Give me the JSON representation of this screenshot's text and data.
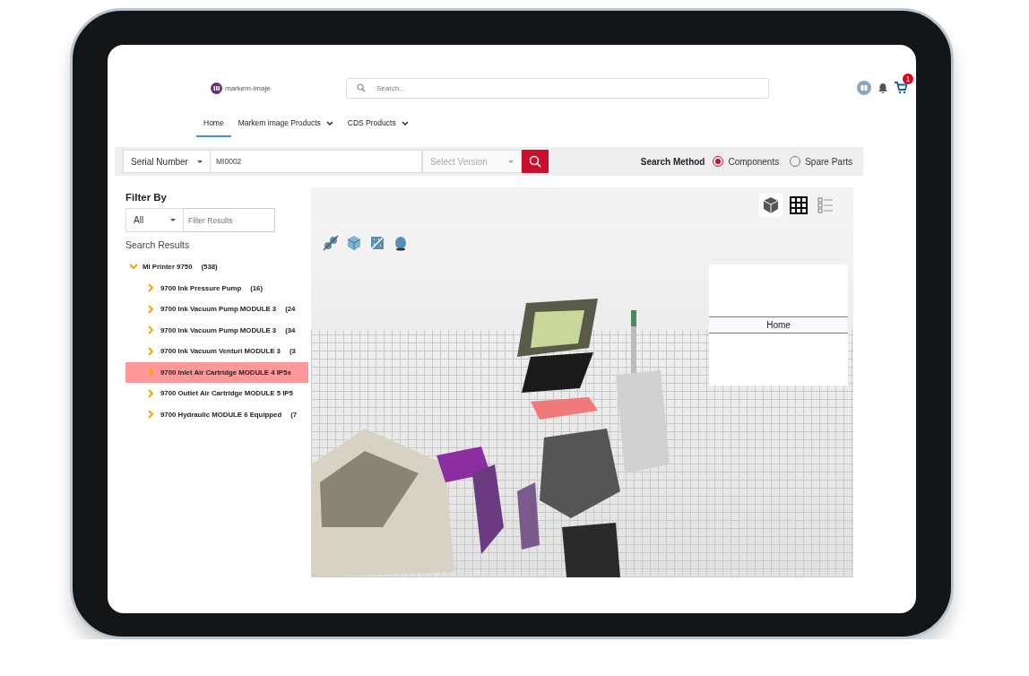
{
  "header": {
    "logo": {
      "text": "markem-imaje"
    },
    "search": {
      "placeholder": "Search..."
    },
    "cart_count": "1"
  },
  "nav": [
    {
      "label": "Home",
      "selected": true,
      "dropdown": false
    },
    {
      "label": "Markem image Products",
      "selected": false,
      "dropdown": true
    },
    {
      "label": "CDS Products",
      "selected": false,
      "dropdown": true
    }
  ],
  "search_bar": {
    "type_select": "Serial Number",
    "serial_value": "MI0002",
    "version_select": {
      "placeholder": "Select Version",
      "disabled": true
    },
    "method_label": "Search Method",
    "methods": [
      {
        "label": "Components",
        "selected": true
      },
      {
        "label": "Spare Parts",
        "selected": false
      }
    ]
  },
  "filter": {
    "title": "Filter By",
    "select": "All",
    "input": {
      "placeholder": "Filter Results"
    }
  },
  "results": {
    "title": "Search Results",
    "tree": [
      {
        "label": "MI Printer 9750",
        "count": "(538)",
        "expanded": true,
        "selected": false,
        "children": [
          {
            "label": "9700 Ink Pressure Pump",
            "count": "(16)",
            "expanded": false,
            "selected": false
          },
          {
            "label": "9700 Ink Vacuum Pump MODULE 3",
            "count": "(24",
            "expanded": false,
            "selected": false
          },
          {
            "label": "9700 Ink Vacuum Pump MODULE 3",
            "count": "(34",
            "expanded": false,
            "selected": false
          },
          {
            "label": "9700 Ink Vacuum Venturi MODULE 3",
            "count": "(3",
            "expanded": false,
            "selected": false
          },
          {
            "label": "9700 Inlet Air Cartridge MODULE 4 IP5x",
            "expanded": false,
            "selected": true
          },
          {
            "label": "9700 Outlet Air Cartridge MODULE 5 IP5",
            "expanded": false,
            "selected": false
          },
          {
            "label": "9700 Hydraulic MODULE 6 Equipped",
            "count": "(7",
            "expanded": false,
            "selected": false
          }
        ]
      }
    ]
  },
  "viewer": {
    "views": [
      {
        "kind": "cube",
        "selected": true
      },
      {
        "kind": "grid",
        "selected": false
      },
      {
        "kind": "list",
        "selected": false
      }
    ],
    "tools": [
      {
        "kind": "explode"
      },
      {
        "kind": "box"
      },
      {
        "kind": "section"
      },
      {
        "kind": "shade"
      }
    ],
    "panel": {
      "item": "Home"
    }
  }
}
